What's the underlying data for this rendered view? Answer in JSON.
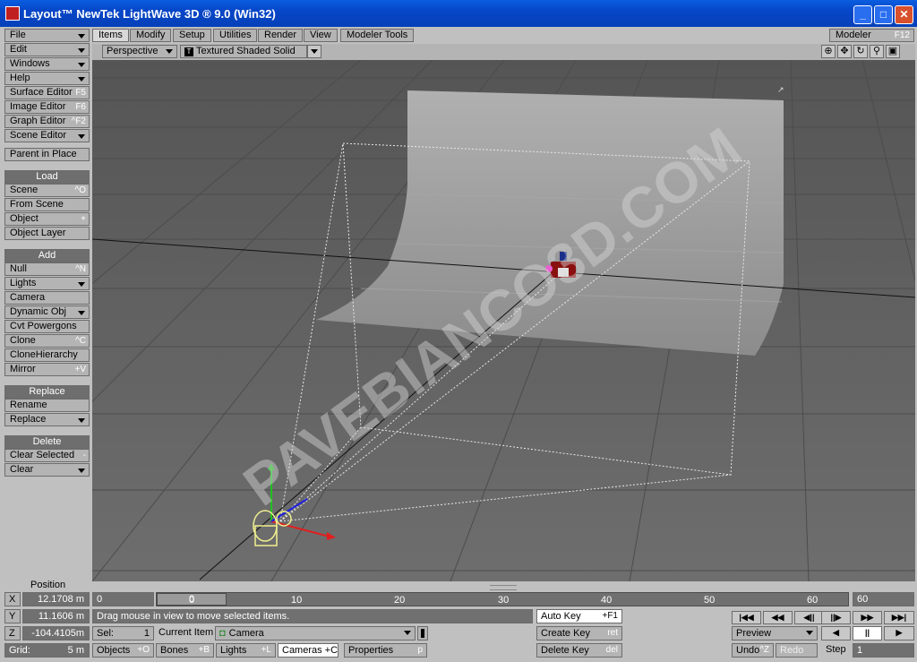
{
  "window": {
    "title": "Layout™ NewTek LightWave 3D ® 9.0 (Win32)",
    "minimize": "_",
    "maximize": "□",
    "close": "✕"
  },
  "sidebar": {
    "file": "File",
    "edit": "Edit",
    "windows": "Windows",
    "help": "Help",
    "surface_editor": "Surface Editor",
    "surface_editor_sc": "F5",
    "image_editor": "Image Editor",
    "image_editor_sc": "F6",
    "graph_editor": "Graph Editor",
    "graph_editor_sc": "^F2",
    "scene_editor": "Scene Editor",
    "parent_in_place": "Parent in Place",
    "load_header": "Load",
    "scene": "Scene",
    "scene_sc": "^O",
    "from_scene": "From Scene",
    "object": "Object",
    "object_sc": "+",
    "object_layer": "Object Layer",
    "add_header": "Add",
    "null": "Null",
    "null_sc": "^N",
    "lights": "Lights",
    "camera": "Camera",
    "dynamic_obj": "Dynamic Obj",
    "cvt_powergons": "Cvt Powergons",
    "clone": "Clone",
    "clone_sc": "^C",
    "clone_hierarchy": "CloneHierarchy",
    "mirror": "Mirror",
    "mirror_sc": "+V",
    "replace_header": "Replace",
    "rename": "Rename",
    "replace": "Replace",
    "delete_header": "Delete",
    "clear_selected": "Clear Selected",
    "clear_selected_sc": "-",
    "clear": "Clear"
  },
  "tabs": {
    "items": "Items",
    "modify": "Modify",
    "setup": "Setup",
    "utilities": "Utilities",
    "render": "Render",
    "view": "View",
    "modeler_tools": "Modeler Tools"
  },
  "modeler_button": {
    "label": "Modeler",
    "shortcut": "F12"
  },
  "viewport": {
    "view_type": "Perspective",
    "render_mode": "Textured Shaded Solid",
    "render_mode_icon": "T",
    "watermark": "PAVEBIANCO3D.COM"
  },
  "position": {
    "label": "Position",
    "x_label": "X",
    "x_value": "12.1708 m",
    "y_label": "Y",
    "y_value": "11.1606 m",
    "z_label": "Z",
    "z_value": "-104.4105m",
    "grid_label": "Grid:",
    "grid_value": "5 m"
  },
  "timeline": {
    "start_frame": "0",
    "end_frame": "60",
    "current_frame": "0",
    "ticks": [
      "0",
      "10",
      "20",
      "30",
      "40",
      "50",
      "60"
    ]
  },
  "status_message": "Drag mouse in view to move selected items.",
  "selection": {
    "sel_label": "Sel:",
    "sel_value": "1",
    "current_item_label": "Current Item",
    "current_item_value": "Camera",
    "objects": "Objects",
    "objects_sc": "+O",
    "bones": "Bones",
    "bones_sc": "+B",
    "lights": "Lights",
    "lights_sc": "+L",
    "cameras": "Cameras +C",
    "properties": "Properties",
    "properties_sc": "p"
  },
  "keys": {
    "auto_key": "Auto Key",
    "auto_key_sc": "+F1",
    "create_key": "Create Key",
    "create_key_sc": "ret",
    "delete_key": "Delete Key",
    "delete_key_sc": "del"
  },
  "playback": {
    "preview": "Preview",
    "undo": "Undo",
    "undo_sc": "^Z",
    "redo": "Redo",
    "step_label": "Step",
    "step_value": "1"
  },
  "transport": {
    "first": "|◀◀",
    "prev_key": "◀◀",
    "prev_frame": "◀||",
    "next_frame": "||▶",
    "next_key": "▶▶",
    "last": "▶▶|",
    "play_back": "◀",
    "pause": "||",
    "play_fwd": "▶"
  }
}
